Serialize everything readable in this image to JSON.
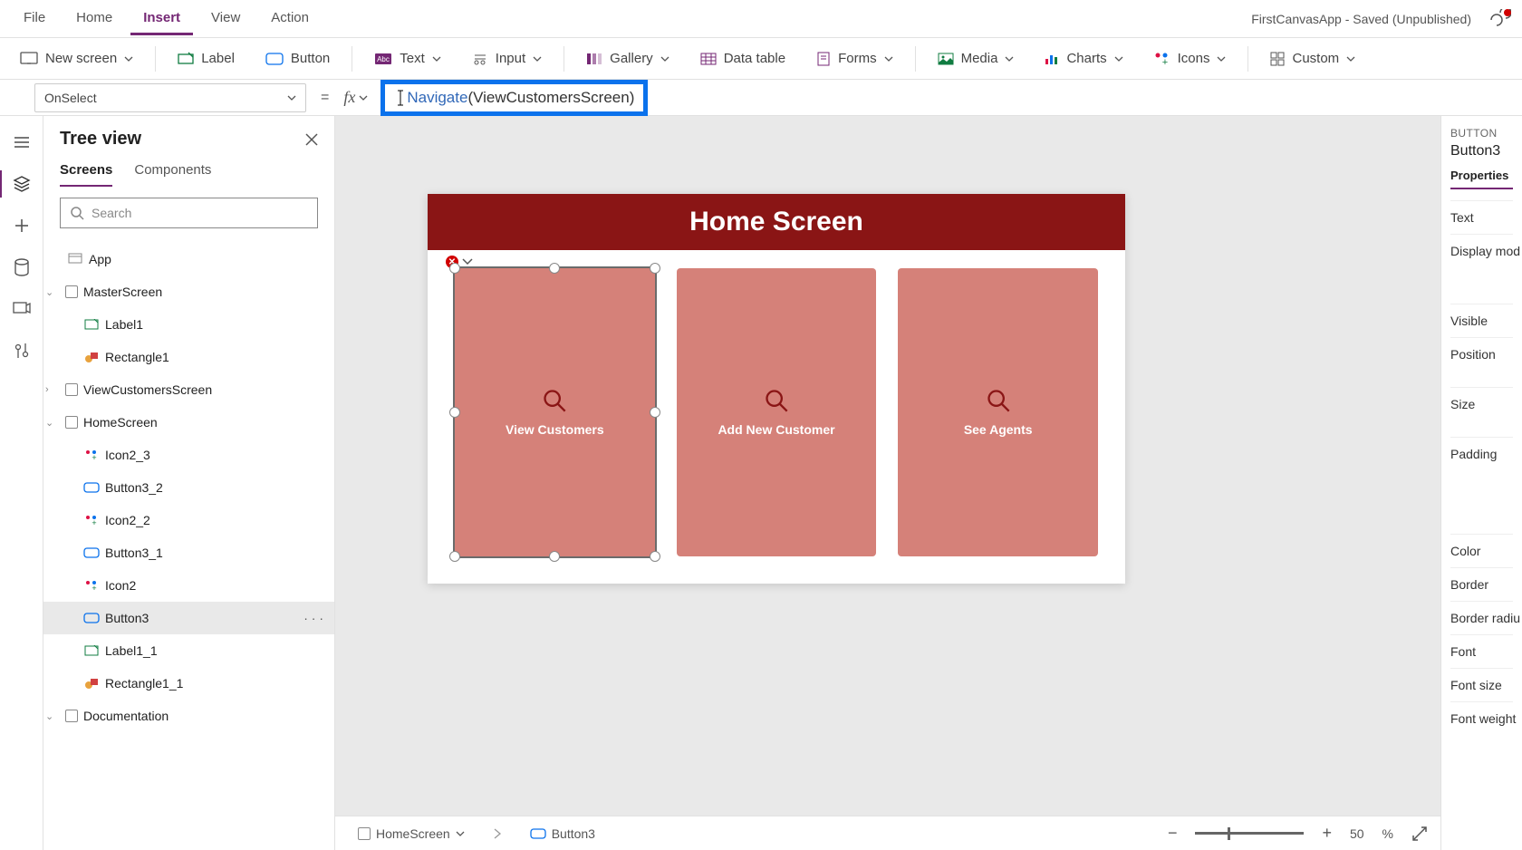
{
  "app_title": "FirstCanvasApp - Saved (Unpublished)",
  "top_menu": {
    "file": "File",
    "home": "Home",
    "insert": "Insert",
    "view": "View",
    "action": "Action"
  },
  "ribbon": {
    "new_screen": "New screen",
    "label": "Label",
    "button": "Button",
    "text": "Text",
    "input": "Input",
    "gallery": "Gallery",
    "data_table": "Data table",
    "forms": "Forms",
    "media": "Media",
    "charts": "Charts",
    "icons": "Icons",
    "custom": "Custom"
  },
  "formula": {
    "property": "OnSelect",
    "fn": "Navigate",
    "args": "(ViewCustomersScreen)"
  },
  "tree_view": {
    "title": "Tree view",
    "tabs": {
      "screens": "Screens",
      "components": "Components"
    },
    "search_placeholder": "Search",
    "items": {
      "app": "App",
      "master": "MasterScreen",
      "label1": "Label1",
      "rect1": "Rectangle1",
      "viewcust": "ViewCustomersScreen",
      "home": "HomeScreen",
      "icon2_3": "Icon2_3",
      "button3_2": "Button3_2",
      "icon2_2": "Icon2_2",
      "button3_1": "Button3_1",
      "icon2": "Icon2",
      "button3": "Button3",
      "label1_1": "Label1_1",
      "rect1_1": "Rectangle1_1",
      "documentation": "Documentation"
    }
  },
  "canvas": {
    "header": "Home Screen",
    "tile1": "View Customers",
    "tile2": "Add New Customer",
    "tile3": "See Agents"
  },
  "right_pane": {
    "type": "BUTTON",
    "name": "Button3",
    "tab": "Properties",
    "props": {
      "text": "Text",
      "display_mode": "Display mod",
      "visible": "Visible",
      "position": "Position",
      "size": "Size",
      "padding": "Padding",
      "color": "Color",
      "border": "Border",
      "border_radius": "Border radiu",
      "font": "Font",
      "font_size": "Font size",
      "font_weight": "Font weight"
    }
  },
  "status": {
    "screen": "HomeScreen",
    "element": "Button3",
    "zoom": "50",
    "pct": "%"
  }
}
